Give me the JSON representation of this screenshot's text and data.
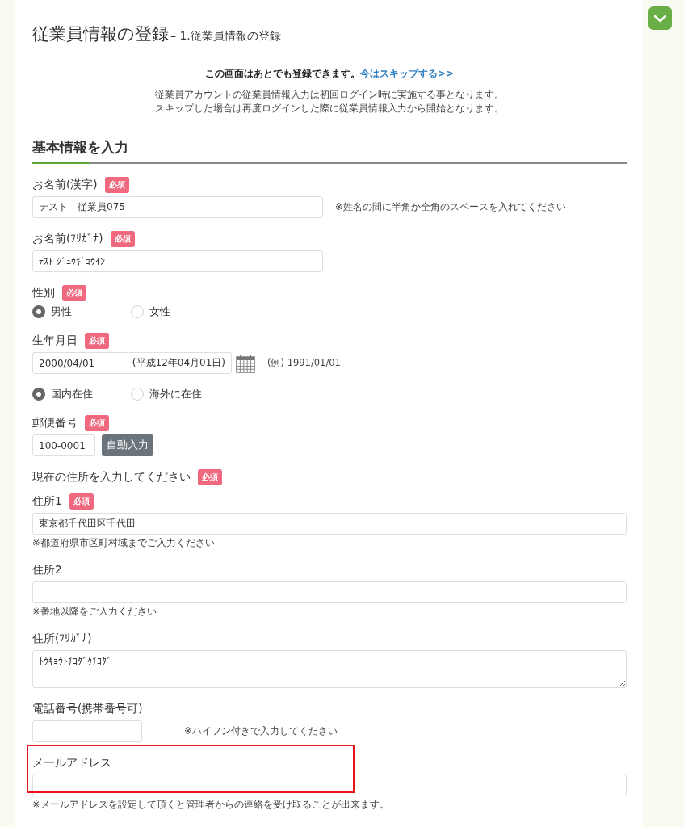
{
  "header": {
    "title": "従業員情報の登録",
    "subtitle": "– 1.従業員情報の登録"
  },
  "expand_button": {
    "kind": "chevron-down"
  },
  "notice": {
    "text": "この画面はあとでも登録できます。",
    "link": "今はスキップする>>"
  },
  "notes": [
    "従業員アカウントの従業員情報入力は初回ログイン時に実施する事となります。",
    "スキップした場合は再度ログインした際に従業員情報入力から開始となります。"
  ],
  "section": {
    "title": "基本情報を入力"
  },
  "fields": [
    {
      "kind": "half",
      "label": "お名前(漢字)",
      "badge": "必須",
      "value": "テスト　従業員075",
      "side_note": "※姓名の間に半角か全角のスペースを入れてください"
    },
    {
      "kind": "half",
      "label": "お名前(ﾌﾘｶﾞﾅ)",
      "badge": "必須",
      "value": "ﾃｽﾄ ｼﾞｭｳｷﾞｮｳｲﾝ"
    },
    {
      "kind": "radio",
      "label": "性別",
      "badge": "必須",
      "options": [
        {
          "label": "男性",
          "selected": true
        },
        {
          "label": "女性",
          "selected": false
        }
      ]
    },
    {
      "kind": "date",
      "label": "生年月日",
      "badge": "必須",
      "value": "2000/04/01",
      "era": "(平成12年04月01日)",
      "side_note": "(例) 1991/01/01"
    },
    {
      "kind": "radio",
      "options": [
        {
          "label": "国内在住",
          "selected": true
        },
        {
          "label": "海外に在住",
          "selected": false
        }
      ]
    },
    {
      "kind": "postal",
      "label": "郵便番号",
      "badge": "必須",
      "value": "100-0001",
      "button": "自動入力"
    },
    {
      "kind": "heading",
      "label": "現在の住所を入力してください",
      "badge": "必須"
    },
    {
      "kind": "full",
      "label": "住所1",
      "badge": "必須",
      "value": "東京都千代田区千代田",
      "note": "※都道府県市区町村域までご入力ください"
    },
    {
      "kind": "full",
      "label": "住所2",
      "note": "※番地以降をご入力ください"
    },
    {
      "kind": "textarea",
      "label": "住所(ﾌﾘｶﾞﾅ)",
      "value": "ﾄｳｷｮｳﾄﾁﾖﾀﾞｸﾁﾖﾀﾞ"
    },
    {
      "kind": "small",
      "label": "電話番号(携帯番号可)",
      "side_note": "※ハイフン付きで入力してください"
    },
    {
      "kind": "full",
      "label": "メールアドレス",
      "highlighted": true,
      "note": "※メールアドレスを設定して頂くと管理者からの連絡を受け取ることが出来ます。"
    }
  ]
}
